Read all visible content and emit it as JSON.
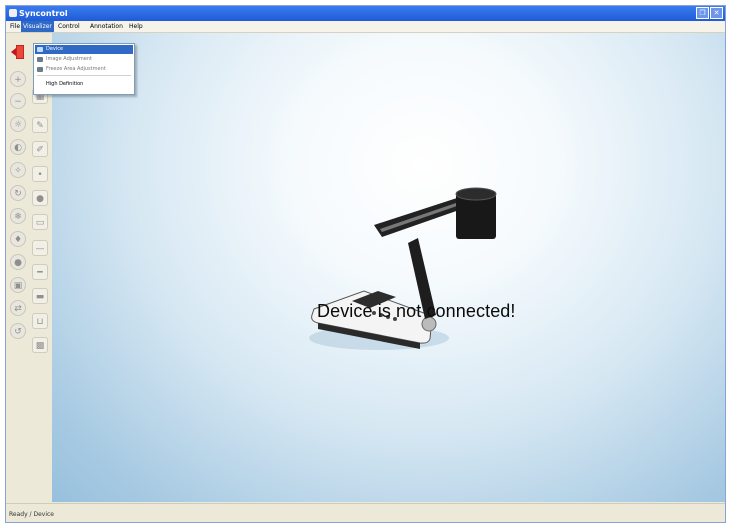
{
  "window": {
    "title": "Syncontrol"
  },
  "titlebar_buttons": {
    "restore": "❐",
    "close": "✕"
  },
  "menubar": {
    "items": [
      "File",
      "Visualizer",
      "Control",
      "Annotation",
      "Help"
    ],
    "active_index": 1
  },
  "dropdown": {
    "items": [
      {
        "label": "Device",
        "icon": "camera-icon",
        "highlighted": true
      },
      {
        "label": "Image Adjustment",
        "icon": "image-icon",
        "highlighted": false
      },
      {
        "label": "Freeze Area Adjustment",
        "icon": "grid-icon",
        "highlighted": false
      },
      {
        "label": "High Definition",
        "icon": "",
        "highlighted": false
      }
    ]
  },
  "canvas": {
    "message": "Device is not connected!"
  },
  "statusbar": {
    "text": "Ready / Device"
  },
  "colors": {
    "titlebar": "#1e5bd6",
    "menu_highlight": "#316ac5",
    "canvas_center": "#ffffff",
    "canvas_edge": "#97c0dd"
  }
}
